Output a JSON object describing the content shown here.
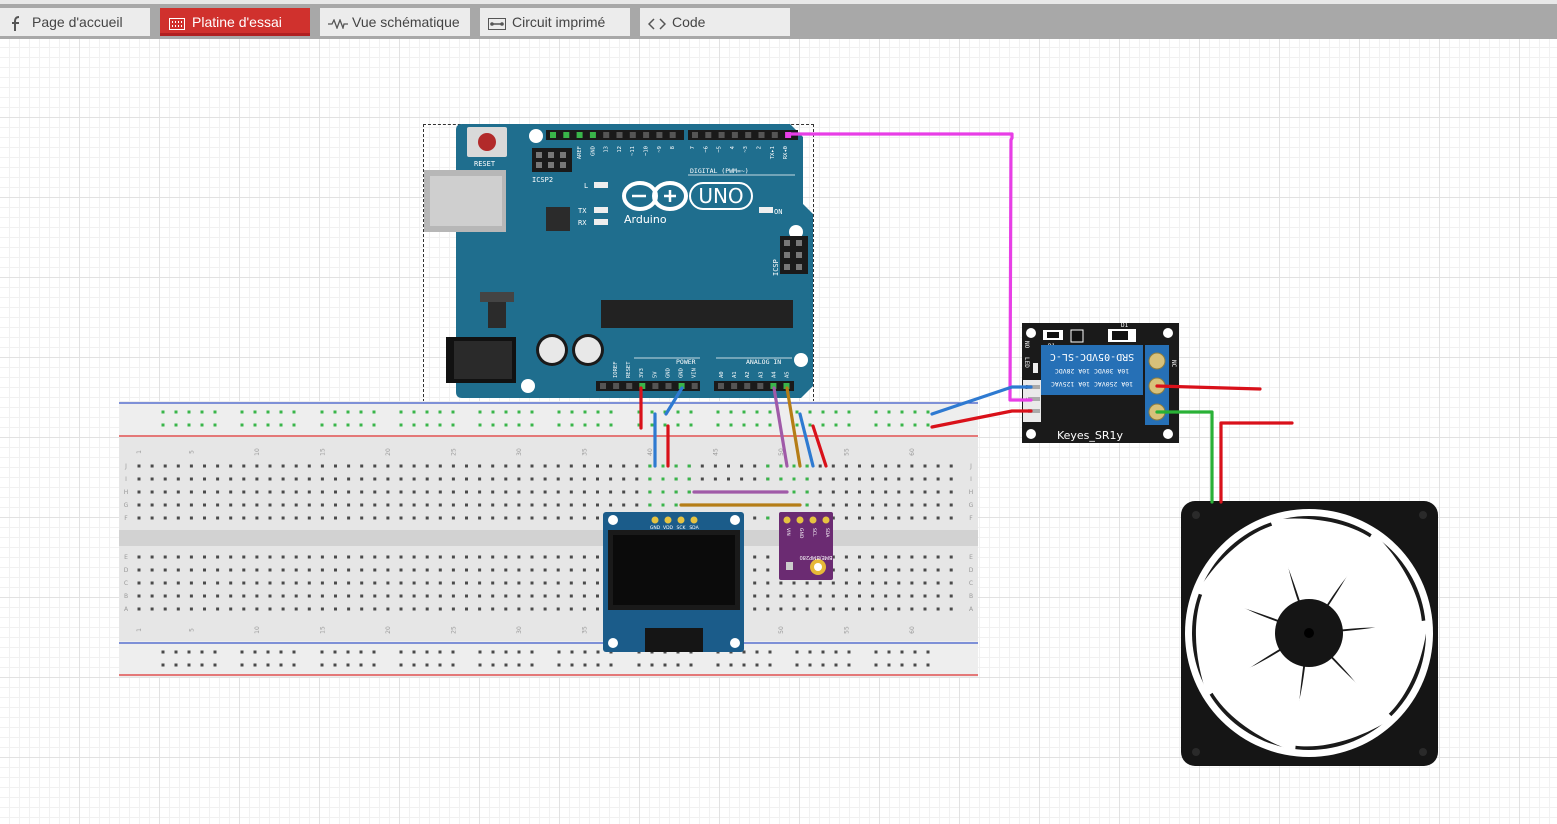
{
  "tabs": [
    {
      "label": "Page d'accueil",
      "icon": "fritzing-logo-icon",
      "active": false
    },
    {
      "label": "Platine d'essai",
      "icon": "breadboard-icon",
      "active": true
    },
    {
      "label": "Vue schématique",
      "icon": "schematic-icon",
      "active": false
    },
    {
      "label": "Circuit imprimé",
      "icon": "pcb-icon",
      "active": false
    },
    {
      "label": "Code",
      "icon": "code-icon",
      "active": false
    }
  ],
  "colors": {
    "active_tab": "#d0312d",
    "arduino_board": "#1f6e8e",
    "wire_magenta": "#e83ee6",
    "wire_blue": "#2e7ad1",
    "wire_red": "#d9111a",
    "wire_green": "#29b136",
    "wire_orange": "#b57d17",
    "wire_purple": "#a05aa8",
    "relay_board": "#1a1a1a",
    "relay_blue": "#2670b6",
    "sensor_purple": "#6b2b72"
  },
  "arduino": {
    "reset_label": "RESET",
    "icsp2_label": "ICSP2",
    "icsp_label": "ICSP",
    "l_label": "L",
    "tx_label": "TX",
    "rx_label": "RX",
    "on_label": "ON",
    "brand": "Arduino",
    "model": "UNO",
    "digital_label": "DIGITAL (PWM=~)",
    "power_label": "POWER",
    "analog_label": "ANALOG IN",
    "top_pins": [
      "AREF",
      "GND",
      "13",
      "12",
      "~11",
      "~10",
      "~9",
      "8",
      "7",
      "~6",
      "~5",
      "4",
      "~3",
      "2",
      "TX▸1",
      "RX◂0"
    ],
    "power_pins": [
      "IOREF",
      "RESET",
      "3V3",
      "5V",
      "GND",
      "GND",
      "VIN"
    ],
    "analog_pins": [
      "A0",
      "A1",
      "A2",
      "A3",
      "A4",
      "A5"
    ]
  },
  "breadboard": {
    "col_numbers": [
      "1",
      "5",
      "10",
      "15",
      "20",
      "25",
      "30",
      "35",
      "40",
      "45",
      "50",
      "55",
      "60"
    ],
    "row_letters_top": [
      "J",
      "I",
      "H",
      "G",
      "F"
    ],
    "row_letters_bottom": [
      "E",
      "D",
      "C",
      "B",
      "A"
    ]
  },
  "oled": {
    "pins": [
      "GND",
      "VDD",
      "SCK",
      "SDA"
    ]
  },
  "bme": {
    "pins": [
      "VIN",
      "GND",
      "SCL",
      "SDA"
    ],
    "name": "BME/BMP280"
  },
  "relay": {
    "name": "Keyes_SR1y",
    "model": "SRD-05VDC-SL-C",
    "rating1": "10A 250VAC  10A 125VAC",
    "rating2": "10A 30VDC  10A 28VDC",
    "d1": "D1",
    "r1": "R1",
    "led": "LED",
    "nc": "NC",
    "no": "NO",
    "pins": [
      "S",
      "+",
      "-"
    ]
  },
  "fan": {
    "blade_count": 7
  }
}
